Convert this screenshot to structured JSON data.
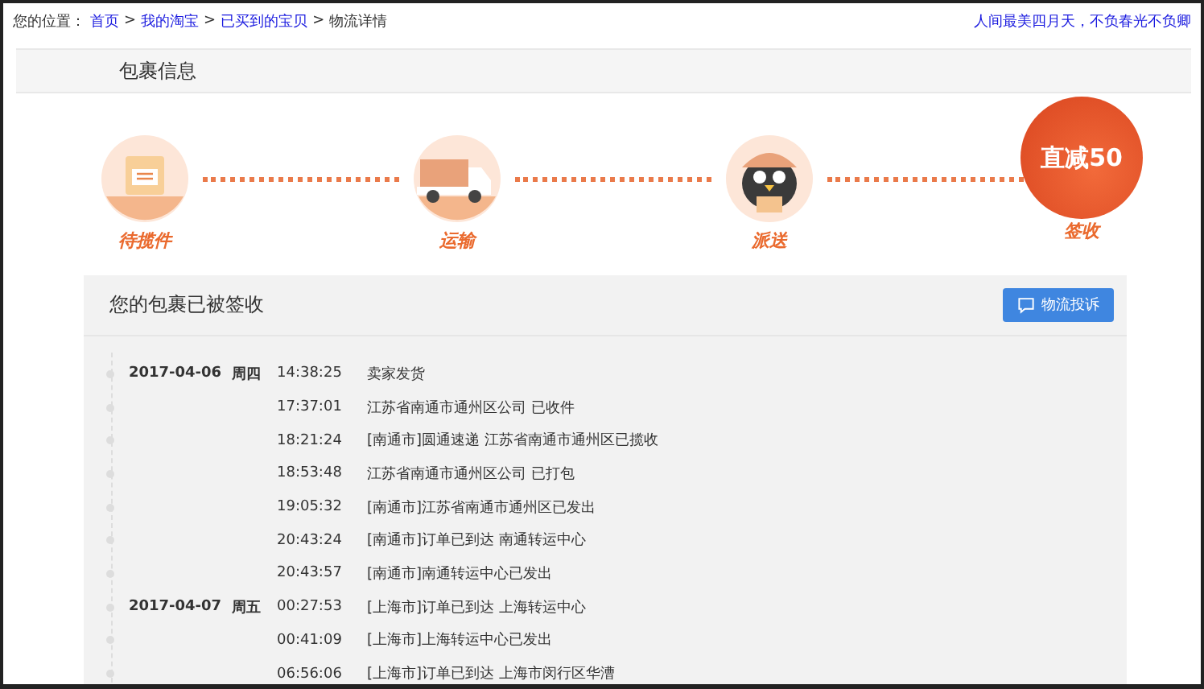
{
  "breadcrumb": {
    "prefix": "您的位置：",
    "links": [
      "首页",
      "我的淘宝",
      "已买到的宝贝"
    ],
    "current": "物流详情",
    "separator": ">"
  },
  "slogan": "人间最美四月天，不负春光不负卿",
  "section_title": "包裹信息",
  "steps": [
    {
      "kind": "box",
      "label": "待揽件"
    },
    {
      "kind": "truck",
      "label": "运输"
    },
    {
      "kind": "courier",
      "label": "派送"
    },
    {
      "kind": "promo",
      "label": "签收",
      "promo_text": "直减50"
    }
  ],
  "panel": {
    "title": "您的包裹已被签收",
    "button": "物流投诉",
    "events": [
      {
        "date": "2017-04-06",
        "weekday": "周四",
        "time": "14:38:25",
        "text": "卖家发货"
      },
      {
        "time": "17:37:01",
        "text": "江苏省南通市通州区公司 已收件"
      },
      {
        "time": "18:21:24",
        "text": "[南通市]圆通速递 江苏省南通市通州区已揽收"
      },
      {
        "time": "18:53:48",
        "text": "江苏省南通市通州区公司 已打包"
      },
      {
        "time": "19:05:32",
        "text": "[南通市]江苏省南通市通州区已发出"
      },
      {
        "time": "20:43:24",
        "text": "[南通市]订单已到达 南通转运中心"
      },
      {
        "time": "20:43:57",
        "text": "[南通市]南通转运中心已发出"
      },
      {
        "date": "2017-04-07",
        "weekday": "周五",
        "time": "00:27:53",
        "text": "[上海市]订单已到达 上海转运中心"
      },
      {
        "time": "00:41:09",
        "text": "[上海市]上海转运中心已发出"
      },
      {
        "time": "06:56:06",
        "text": "[上海市]订单已到达 上海市闵行区华漕"
      }
    ]
  }
}
